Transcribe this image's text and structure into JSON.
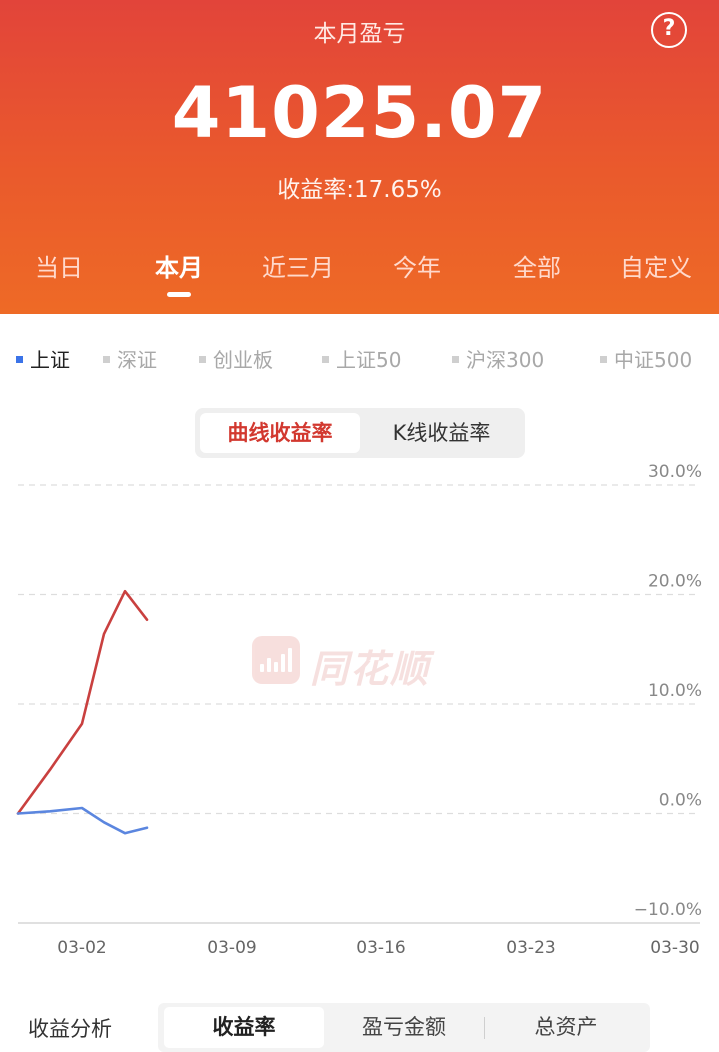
{
  "header": {
    "title": "本月盈亏",
    "help_icon": "?",
    "amount": "41025.07",
    "rate_label": "收益率:",
    "rate_value": "17.65%"
  },
  "period_tabs": [
    {
      "label": "当日",
      "active": false
    },
    {
      "label": "本月",
      "active": true
    },
    {
      "label": "近三月",
      "active": false
    },
    {
      "label": "今年",
      "active": false
    },
    {
      "label": "全部",
      "active": false
    },
    {
      "label": "自定义",
      "active": false
    }
  ],
  "indices": [
    {
      "label": "上证",
      "active": true
    },
    {
      "label": "深证",
      "active": false
    },
    {
      "label": "创业板",
      "active": false
    },
    {
      "label": "上证50",
      "active": false
    },
    {
      "label": "沪深300",
      "active": false
    },
    {
      "label": "中证500",
      "active": false
    }
  ],
  "chart_mode": {
    "options": [
      "曲线收益率",
      "K线收益率"
    ],
    "selected": "曲线收益率"
  },
  "watermark": {
    "text": "同花顺"
  },
  "chart_data": {
    "type": "line",
    "title": "",
    "xlabel": "",
    "ylabel": "",
    "ylim": [
      -10,
      30
    ],
    "y_ticks": [
      "30.0%",
      "20.0%",
      "10.0%",
      "0.0%",
      "−10.0%"
    ],
    "y_tick_values": [
      30,
      20,
      10,
      0,
      -10
    ],
    "x_tick_labels": [
      "03-02",
      "03-09",
      "03-16",
      "03-23",
      "03-30"
    ],
    "x": [
      "03-01",
      "03-02",
      "03-03",
      "03-04",
      "03-05",
      "03-06",
      "03-07"
    ],
    "series": [
      {
        "values": [
          0.0,
          4.0,
          8.2,
          16.4,
          20.3,
          17.7
        ],
        "color": "#c9403f"
      },
      {
        "values": [
          0.0,
          0.2,
          0.5,
          -0.8,
          -1.8,
          -1.3
        ],
        "color": "#5b86df"
      }
    ],
    "grid": true,
    "grid_style": "dashed"
  },
  "bottom": {
    "label": "收益分析",
    "tabs": [
      {
        "label": "收益率",
        "active": true
      },
      {
        "label": "盈亏金额",
        "active": false
      },
      {
        "label": "总资产",
        "active": false
      }
    ]
  },
  "colors": {
    "header_top": "#e2443a",
    "header_bottom": "#ee6a26",
    "accent_red": "#d2382f",
    "blue": "#3b73e8"
  }
}
